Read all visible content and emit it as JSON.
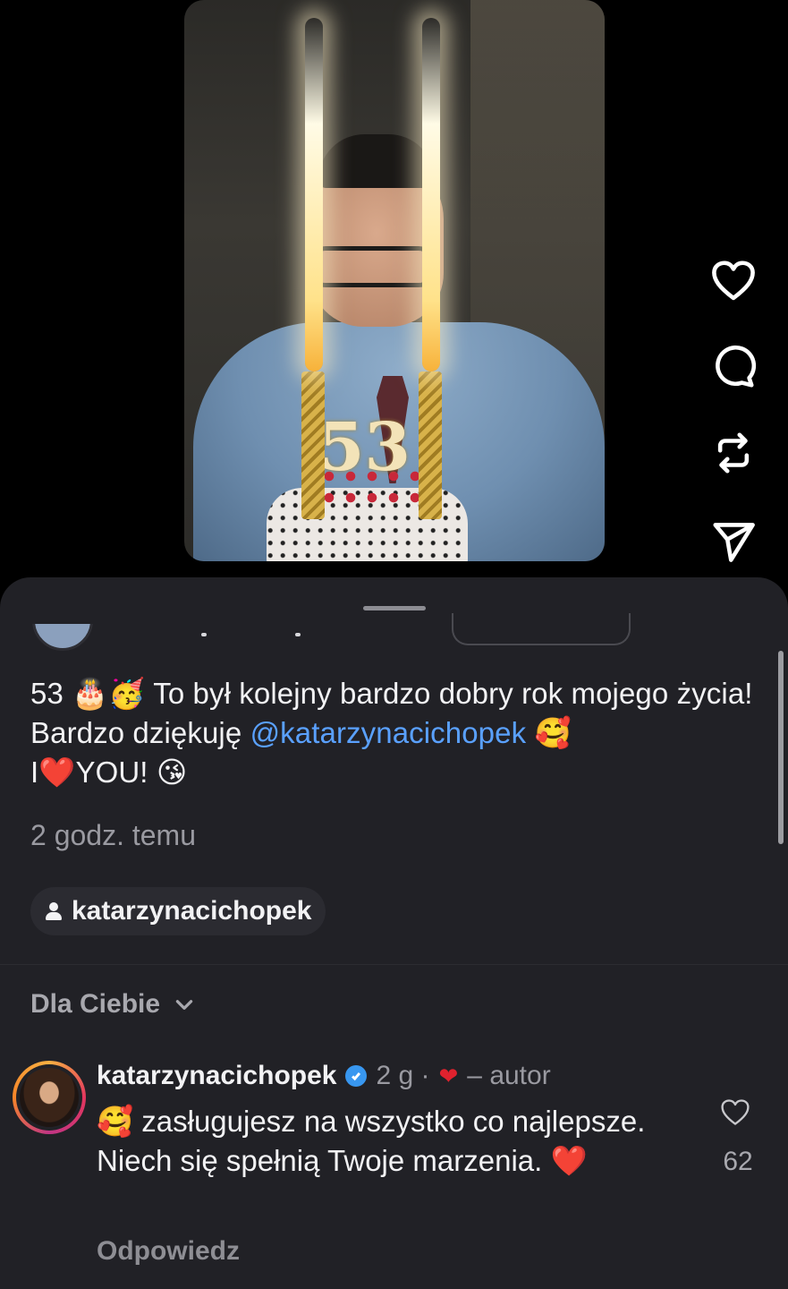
{
  "video": {
    "cake_number": "53"
  },
  "actions": {
    "like": "heart-icon",
    "comment": "comment-icon",
    "repost": "repost-icon",
    "share": "send-icon"
  },
  "post": {
    "caption_part1": "53 🎂🥳 To był kolejny bardzo dobry rok mojego życia! Bardzo dziękuję ",
    "mention": "@katarzynacichopek",
    "caption_part2": " 🥰",
    "caption_line3_a": "I",
    "caption_heart": "❤️",
    "caption_line3_b": "YOU! 😘",
    "time": "2 godz. temu",
    "tagged_user": "katarzynacichopek"
  },
  "comments_section": {
    "sort_label": "Dla Ciebie"
  },
  "comment": {
    "username": "katarzynacichopek",
    "age": "2 g ·",
    "author_heart": "❤",
    "author_label": "– autor",
    "text_a": "🥰 zasługujesz na wszystko co najlepsze. Niech się spełnią Twoje marzenia. ",
    "text_heart": "❤️",
    "likes": "62",
    "reply_label": "Odpowiedz"
  },
  "colors": {
    "background": "#000000",
    "sheet": "#212126",
    "mention": "#5aa1ff",
    "heart": "#e0222e",
    "verified": "#3897f0"
  }
}
